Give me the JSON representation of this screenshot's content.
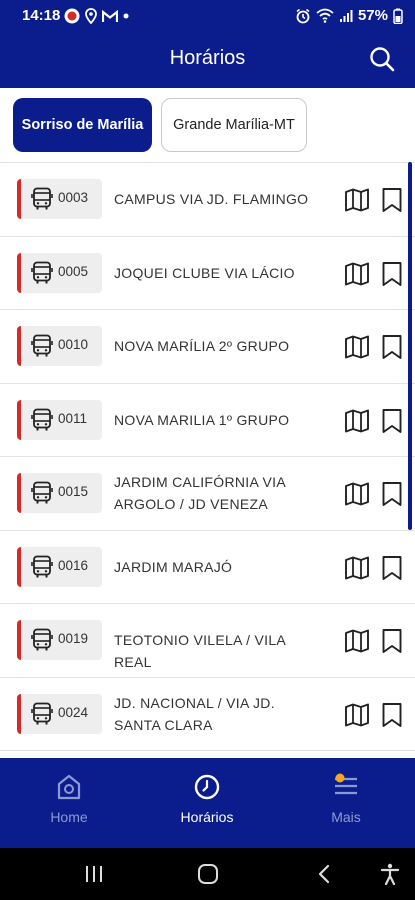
{
  "status_bar": {
    "time": "14:18",
    "battery": "57%",
    "left_icons": [
      "app-notification-icon",
      "location-icon",
      "gmail-icon",
      "dot-icon"
    ],
    "right_icons": [
      "alarm-icon",
      "wifi-icon",
      "signal-icon",
      "battery-icon"
    ]
  },
  "app_bar": {
    "title": "Horários",
    "search_icon": "search-icon"
  },
  "tabs": [
    {
      "label": "Sorriso de Marília",
      "active": true
    },
    {
      "label": "Grande Marília-MT",
      "active": false
    }
  ],
  "routes": [
    {
      "code": "0003",
      "name": "CAMPUS VIA JD. FLAMINGO"
    },
    {
      "code": "0005",
      "name": "JOQUEI CLUBE VIA LÁCIO"
    },
    {
      "code": "0010",
      "name": "NOVA MARÍLIA 2º GRUPO"
    },
    {
      "code": "0011",
      "name": "NOVA MARILIA 1º GRUPO"
    },
    {
      "code": "0015",
      "name": "JARDIM CALIFÓRNIA VIA ARGOLO / JD VENEZA"
    },
    {
      "code": "0016",
      "name": "JARDIM MARAJÓ"
    },
    {
      "code": "0019",
      "name": "TEOTONIO VILELA / VILA REAL"
    },
    {
      "code": "0024",
      "name": "JD. NACIONAL / VIA  JD. SANTA CLARA"
    }
  ],
  "bottom_nav": [
    {
      "label": "Home",
      "icon": "home-icon",
      "active": false
    },
    {
      "label": "Horários",
      "icon": "clock-icon",
      "active": true
    },
    {
      "label": "Mais",
      "icon": "menu-icon",
      "active": false
    }
  ],
  "colors": {
    "primary": "#0b1d8c",
    "route_accent": "#d62a2a",
    "badge_bg": "#eeeeee",
    "notification_dot": "#f5a623"
  }
}
